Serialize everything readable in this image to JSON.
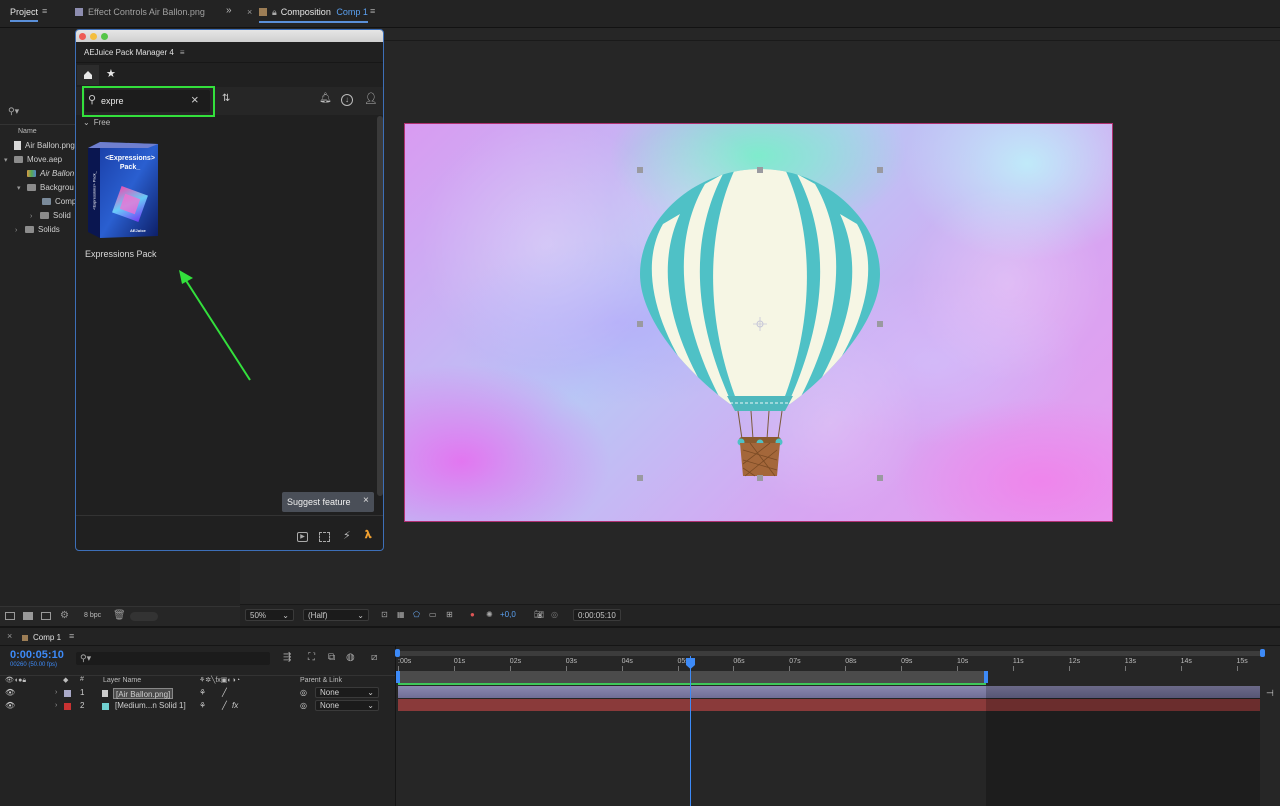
{
  "tabs": {
    "project": "Project",
    "effect_controls": "Effect Controls Air Ballon.png",
    "composition_prefix": "Composition",
    "composition_name": "Comp 1"
  },
  "project_panel": {
    "search_placeholder": "",
    "column_name": "Name",
    "items": [
      {
        "label": "Air Ballon.png",
        "icon": "file-icon"
      },
      {
        "label": "Move.aep",
        "icon": "folder-icon"
      },
      {
        "label": "Air Ballon",
        "icon": "comp-icon"
      },
      {
        "label": "Backgrou",
        "icon": "folder-icon"
      },
      {
        "label": "Comp",
        "icon": "comp-icon"
      },
      {
        "label": "Solid",
        "icon": "folder-icon"
      },
      {
        "label": "Solids",
        "icon": "folder-icon"
      }
    ],
    "bit_depth": "8 bpc"
  },
  "plugin": {
    "title": "AEJuice Pack Manager 4",
    "search_value": "expre",
    "section_label": "Free",
    "pack": {
      "name": "Expressions Pack",
      "box_title": "<Expressions> Pack_",
      "box_side": "<Expressions> Pack_",
      "brand": "AEJuice"
    },
    "suggest_label": "Suggest feature"
  },
  "viewer_toolbar": {
    "zoom": "50%",
    "resolution": "(Half)",
    "exposure": "+0,0",
    "timecode": "0:00:05:10"
  },
  "timeline": {
    "tab": "Comp 1",
    "timecode": "0:00:05:10",
    "frames": "00260 (50.00 fps)",
    "col_layer_name": "Layer Name",
    "col_parent": "Parent & Link",
    "ticks": [
      ":00s",
      "01s",
      "02s",
      "03s",
      "04s",
      "05s",
      "06s",
      "07s",
      "08s",
      "09s",
      "10s",
      "11s",
      "12s",
      "13s",
      "14s",
      "15s"
    ],
    "layers": [
      {
        "num": "1",
        "name": "[Air Ballon.png]",
        "parent": "None",
        "color": "#a9a9c8"
      },
      {
        "num": "2",
        "name": "[Medium...n Solid 1]",
        "parent": "None",
        "color": "#6fcfcf"
      }
    ]
  },
  "colors": {
    "accent_blue": "#3d8af7",
    "highlight_green": "#33e03c",
    "balloon_teal": "#4fc1c6",
    "balloon_cream": "#f6f6e4"
  }
}
